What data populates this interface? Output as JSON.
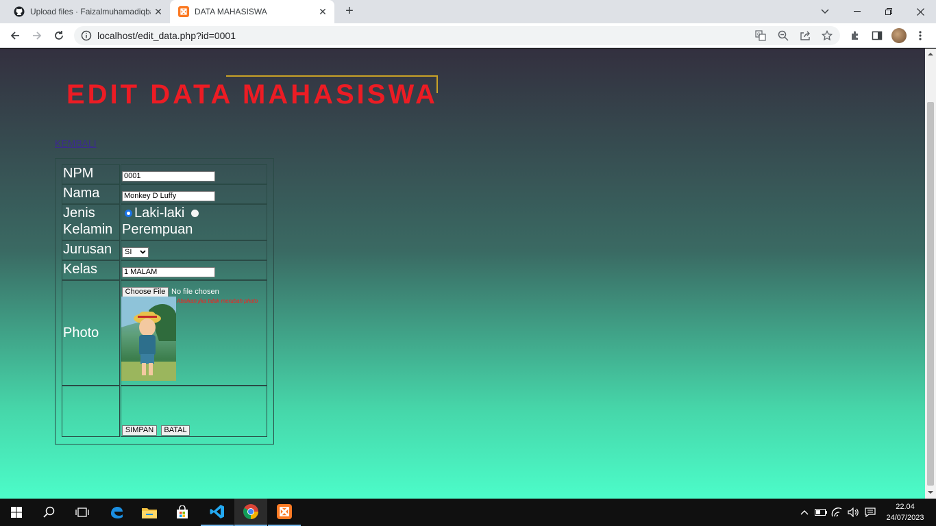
{
  "browser": {
    "tabs": [
      {
        "title": "Upload files · Faizalmuhamadiqbal",
        "icon": "github-icon"
      },
      {
        "title": "DATA MAHASISWA",
        "icon": "xampp-icon"
      }
    ],
    "url": "localhost/edit_data.php?id=0001"
  },
  "page": {
    "heading": "EDIT DATA MAHASISWA",
    "back_link": "KEMBALI",
    "form": {
      "npm_label": "NPM",
      "npm_value": "0001",
      "nama_label": "Nama",
      "nama_value": "Monkey D Luffy",
      "jk_label_1": "Jenis",
      "jk_label_2": "Kelamin",
      "jk_option_1": "Laki-laki",
      "jk_option_2": "Perempuan",
      "jk_selected": "Laki-laki",
      "jurusan_label": "Jurusan",
      "jurusan_value": "SI",
      "kelas_label": "Kelas",
      "kelas_value": "1 MALAM",
      "photo_label": "Photo",
      "file_button": "Choose File",
      "file_status": "No file chosen",
      "photo_hint": "Abaikan jika tidak merubah photo",
      "save_button": "SIMPAN",
      "cancel_button": "BATAL"
    }
  },
  "taskbar": {
    "time": "22.04",
    "date": "24/07/2023"
  },
  "colors": {
    "heading": "#ec1c24",
    "heading_frame": "#c9a227",
    "gradient_top": "#33303f",
    "gradient_bottom": "#4cfcc9"
  }
}
